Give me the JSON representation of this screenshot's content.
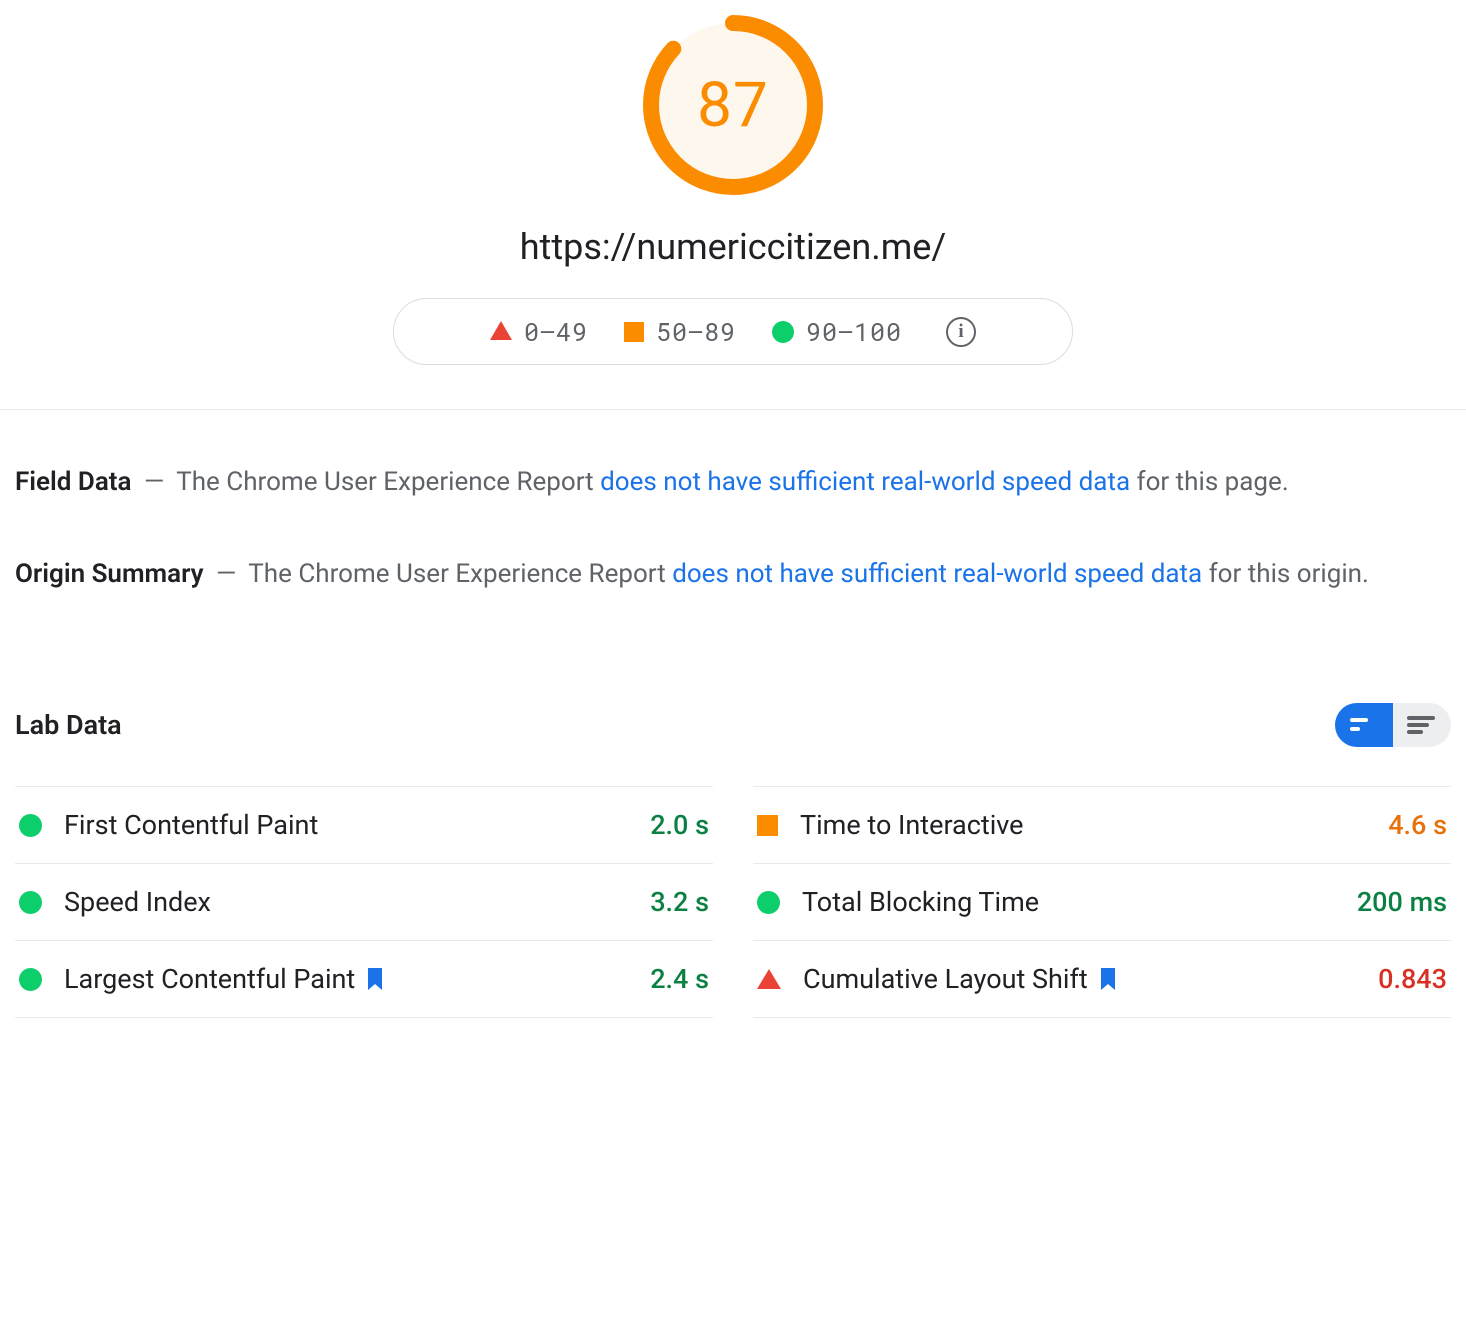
{
  "score": {
    "value": "87",
    "percent": 87,
    "color": "#fb8c00",
    "bg": "#fef7ee"
  },
  "url": "https://numericcitizen.me/",
  "legend": {
    "poor": "0–49",
    "avg": "50–89",
    "good": "90–100"
  },
  "field_data": {
    "label": "Field Data",
    "pre": "The Chrome User Experience Report ",
    "link": "does not have sufficient real-world speed data",
    "post": " for this page."
  },
  "origin_summary": {
    "label": "Origin Summary",
    "pre": "The Chrome User Experience Report ",
    "link": "does not have sufficient real-world speed data",
    "post": " for this origin."
  },
  "lab_data_heading": "Lab Data",
  "metrics": {
    "fcp": {
      "name": "First Contentful Paint",
      "value": "2.0 s",
      "shape": "dot",
      "color": "green",
      "bookmark": false
    },
    "tti": {
      "name": "Time to Interactive",
      "value": "4.6 s",
      "shape": "square",
      "color": "orange",
      "bookmark": false
    },
    "si": {
      "name": "Speed Index",
      "value": "3.2 s",
      "shape": "dot",
      "color": "green",
      "bookmark": false
    },
    "tbt": {
      "name": "Total Blocking Time",
      "value": "200 ms",
      "shape": "dot",
      "color": "green",
      "bookmark": false
    },
    "lcp": {
      "name": "Largest Contentful Paint",
      "value": "2.4 s",
      "shape": "dot",
      "color": "green",
      "bookmark": true
    },
    "cls": {
      "name": "Cumulative Layout Shift",
      "value": "0.843",
      "shape": "triangle",
      "color": "red",
      "bookmark": true
    }
  }
}
